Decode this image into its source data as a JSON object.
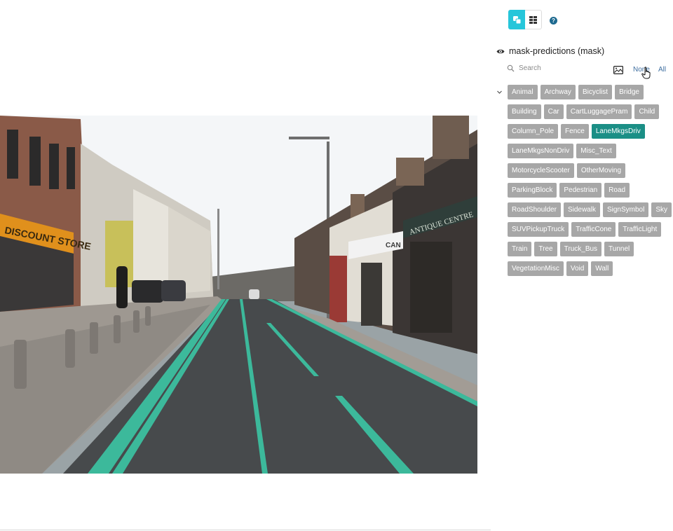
{
  "toolbar": {
    "modes": [
      {
        "icon": "overlay-mode-icon",
        "active": true
      },
      {
        "icon": "grid-mode-icon",
        "active": false
      }
    ],
    "help_icon": "question-icon",
    "help_text": "?"
  },
  "field": {
    "title": "mask-predictions (mask)",
    "visibility_icon": "eye-icon"
  },
  "search": {
    "placeholder": "Search",
    "value": ""
  },
  "actions": {
    "none_label": "None",
    "all_label": "All"
  },
  "colors": {
    "accent": "#26c6da",
    "tag_default": "#a7a7a7",
    "tag_selected": "#1b8f86",
    "lane_marking": "#3cb99b"
  },
  "labels": [
    {
      "name": "Animal",
      "selected": false
    },
    {
      "name": "Archway",
      "selected": false
    },
    {
      "name": "Bicyclist",
      "selected": false
    },
    {
      "name": "Bridge",
      "selected": false
    },
    {
      "name": "Building",
      "selected": false
    },
    {
      "name": "Car",
      "selected": false
    },
    {
      "name": "CartLuggagePram",
      "selected": false
    },
    {
      "name": "Child",
      "selected": false
    },
    {
      "name": "Column_Pole",
      "selected": false
    },
    {
      "name": "Fence",
      "selected": false
    },
    {
      "name": "LaneMkgsDriv",
      "selected": true
    },
    {
      "name": "LaneMkgsNonDriv",
      "selected": false
    },
    {
      "name": "Misc_Text",
      "selected": false
    },
    {
      "name": "MotorcycleScooter",
      "selected": false
    },
    {
      "name": "OtherMoving",
      "selected": false
    },
    {
      "name": "ParkingBlock",
      "selected": false
    },
    {
      "name": "Pedestrian",
      "selected": false
    },
    {
      "name": "Road",
      "selected": false
    },
    {
      "name": "RoadShoulder",
      "selected": false
    },
    {
      "name": "Sidewalk",
      "selected": false
    },
    {
      "name": "SignSymbol",
      "selected": false
    },
    {
      "name": "Sky",
      "selected": false
    },
    {
      "name": "SUVPickupTruck",
      "selected": false
    },
    {
      "name": "TrafficCone",
      "selected": false
    },
    {
      "name": "TrafficLight",
      "selected": false
    },
    {
      "name": "Train",
      "selected": false
    },
    {
      "name": "Tree",
      "selected": false
    },
    {
      "name": "Truck_Bus",
      "selected": false
    },
    {
      "name": "Tunnel",
      "selected": false
    },
    {
      "name": "VegetationMisc",
      "selected": false
    },
    {
      "name": "Void",
      "selected": false
    },
    {
      "name": "Wall",
      "selected": false
    }
  ],
  "scene": {
    "shop_signs": [
      "DISCOUNT STORE",
      "ANTIQUE CENTRE",
      "CAN"
    ]
  }
}
